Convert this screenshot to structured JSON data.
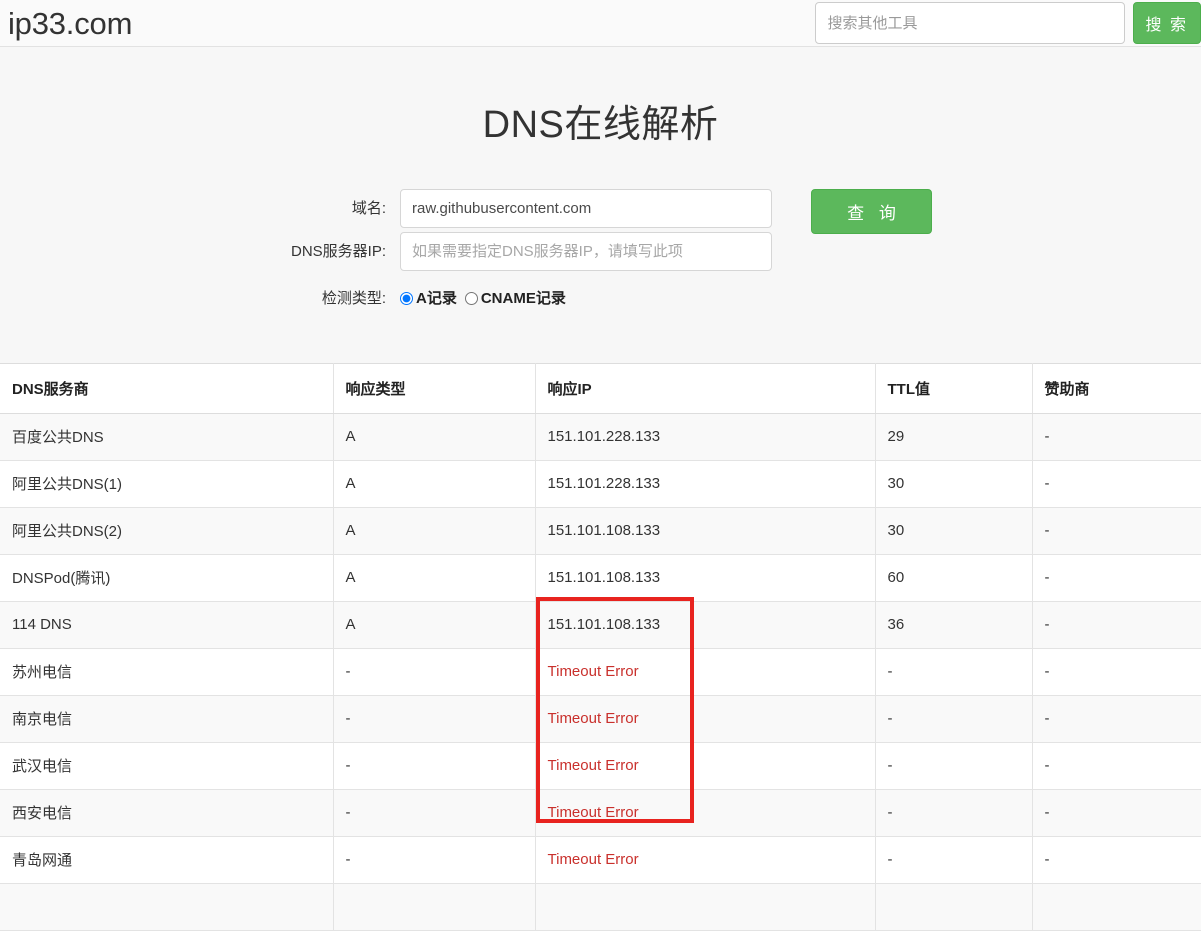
{
  "header": {
    "brand": "ip33.com",
    "search_placeholder": "搜索其他工具",
    "search_button": "搜 索"
  },
  "page": {
    "title": "DNS在线解析"
  },
  "form": {
    "domain_label": "域名:",
    "domain_value": "raw.githubusercontent.com",
    "dns_server_label": "DNS服务器IP:",
    "dns_server_placeholder": "如果需要指定DNS服务器IP，请填写此项",
    "dns_server_value": "",
    "query_type_label": "检测类型:",
    "radio_a_label": "A记录",
    "radio_cname_label": "CNAME记录",
    "selected_type": "A记录",
    "submit_label": "查 询"
  },
  "table": {
    "headers": [
      "DNS服务商",
      "响应类型",
      "响应IP",
      "TTL值",
      "赞助商"
    ],
    "rows": [
      {
        "provider": "百度公共DNS",
        "type": "A",
        "ip": "151.101.228.133",
        "ttl": "29",
        "sponsor": "-",
        "error": false
      },
      {
        "provider": "阿里公共DNS(1)",
        "type": "A",
        "ip": "151.101.228.133",
        "ttl": "30",
        "sponsor": "-",
        "error": false
      },
      {
        "provider": "阿里公共DNS(2)",
        "type": "A",
        "ip": "151.101.108.133",
        "ttl": "30",
        "sponsor": "-",
        "error": false
      },
      {
        "provider": "DNSPod(腾讯)",
        "type": "A",
        "ip": "151.101.108.133",
        "ttl": "60",
        "sponsor": "-",
        "error": false
      },
      {
        "provider": "114 DNS",
        "type": "A",
        "ip": "151.101.108.133",
        "ttl": "36",
        "sponsor": "-",
        "error": false
      },
      {
        "provider": "苏州电信",
        "type": "-",
        "ip": "Timeout Error",
        "ttl": "-",
        "sponsor": "-",
        "error": true
      },
      {
        "provider": "南京电信",
        "type": "-",
        "ip": "Timeout Error",
        "ttl": "-",
        "sponsor": "-",
        "error": true
      },
      {
        "provider": "武汉电信",
        "type": "-",
        "ip": "Timeout Error",
        "ttl": "-",
        "sponsor": "-",
        "error": true
      },
      {
        "provider": "西安电信",
        "type": "-",
        "ip": "Timeout Error",
        "ttl": "-",
        "sponsor": "-",
        "error": true
      },
      {
        "provider": "青岛网通",
        "type": "-",
        "ip": "Timeout Error",
        "ttl": "-",
        "sponsor": "-",
        "error": true
      },
      {
        "provider": "",
        "type": "",
        "ip": "",
        "ttl": "",
        "sponsor": "",
        "error": false
      }
    ]
  },
  "colors": {
    "accent_green": "#5cb85c",
    "error_red": "#c9302c",
    "highlight_red": "#e8231f"
  }
}
